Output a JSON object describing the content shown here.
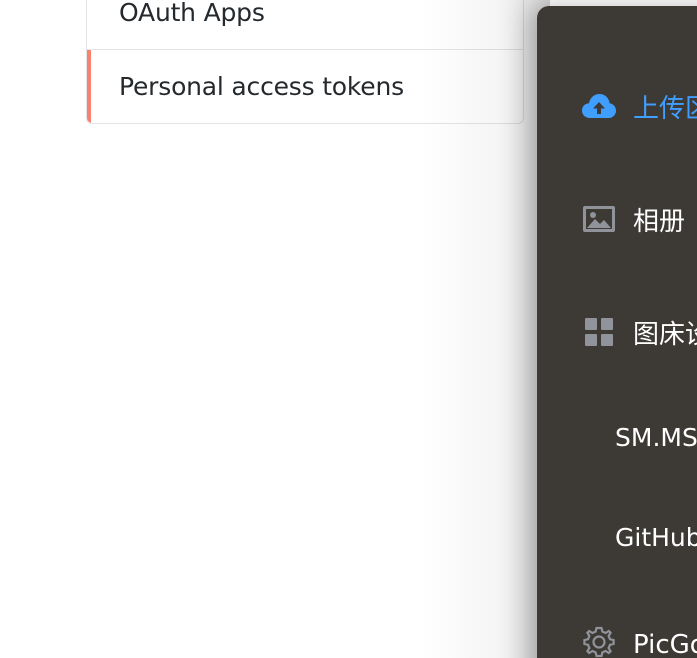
{
  "github_settings_nav": {
    "items": [
      {
        "label": "OAuth Apps",
        "selected": false
      },
      {
        "label": "Personal access tokens",
        "selected": true
      }
    ],
    "selected_accent_color": "#f9826c"
  },
  "picgo_sidebar": {
    "background_color": "#3d3a36",
    "active_color": "#409eff",
    "items": [
      {
        "label": "上传区",
        "icon": "cloud-upload-icon",
        "active": true
      },
      {
        "label": "相册",
        "icon": "image-icon",
        "active": false
      },
      {
        "label": "图床设置",
        "icon": "grid-icon",
        "active": false
      },
      {
        "label": "SM.MS图床"
      },
      {
        "label": "GitHub图床"
      },
      {
        "label": "PicGo设置",
        "icon": "gear-icon",
        "active": false
      }
    ]
  }
}
